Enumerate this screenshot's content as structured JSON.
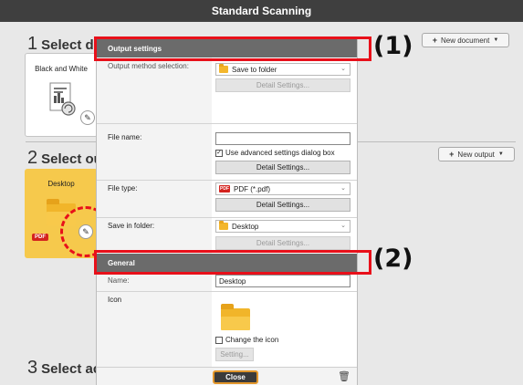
{
  "window": {
    "title": "Standard Scanning"
  },
  "sections": {
    "select_document": {
      "number": "1",
      "label": "Select do",
      "new_button": "New document"
    },
    "select_output": {
      "number": "2",
      "label": "Select out",
      "new_button": "New output"
    },
    "select_action": {
      "number": "3",
      "label": "Select act"
    }
  },
  "cards": {
    "document": {
      "label": "Black and White"
    },
    "output": {
      "label": "Desktop",
      "badge": "PDF"
    }
  },
  "dialog": {
    "output_settings_header": "Output settings",
    "output_method_label": "Output method selection:",
    "output_method_value": "Save to folder",
    "detail_settings_1": "Detail Settings...",
    "file_name_label": "File name:",
    "file_name_value": "",
    "use_advanced_label": "Use advanced settings dialog box",
    "use_advanced_checked": true,
    "detail_settings_2": "Detail Settings...",
    "file_type_label": "File type:",
    "file_type_value": "PDF (*.pdf)",
    "detail_settings_3": "Detail Settings...",
    "save_in_folder_label": "Save in folder:",
    "save_in_folder_value": "Desktop",
    "detail_settings_4": "Detail Settings...",
    "general_header": "General",
    "name_label": "Name:",
    "name_value": "Desktop",
    "icon_label": "Icon",
    "change_icon_label": "Change the icon",
    "change_icon_checked": false,
    "setting_button": "Setting...",
    "close_button": "Close"
  },
  "callouts": {
    "one": "(1)",
    "two": "(2)"
  },
  "colors": {
    "highlight": "#e8101a",
    "card_selected": "#f6c94c",
    "titlebar": "#3f3f3f"
  }
}
